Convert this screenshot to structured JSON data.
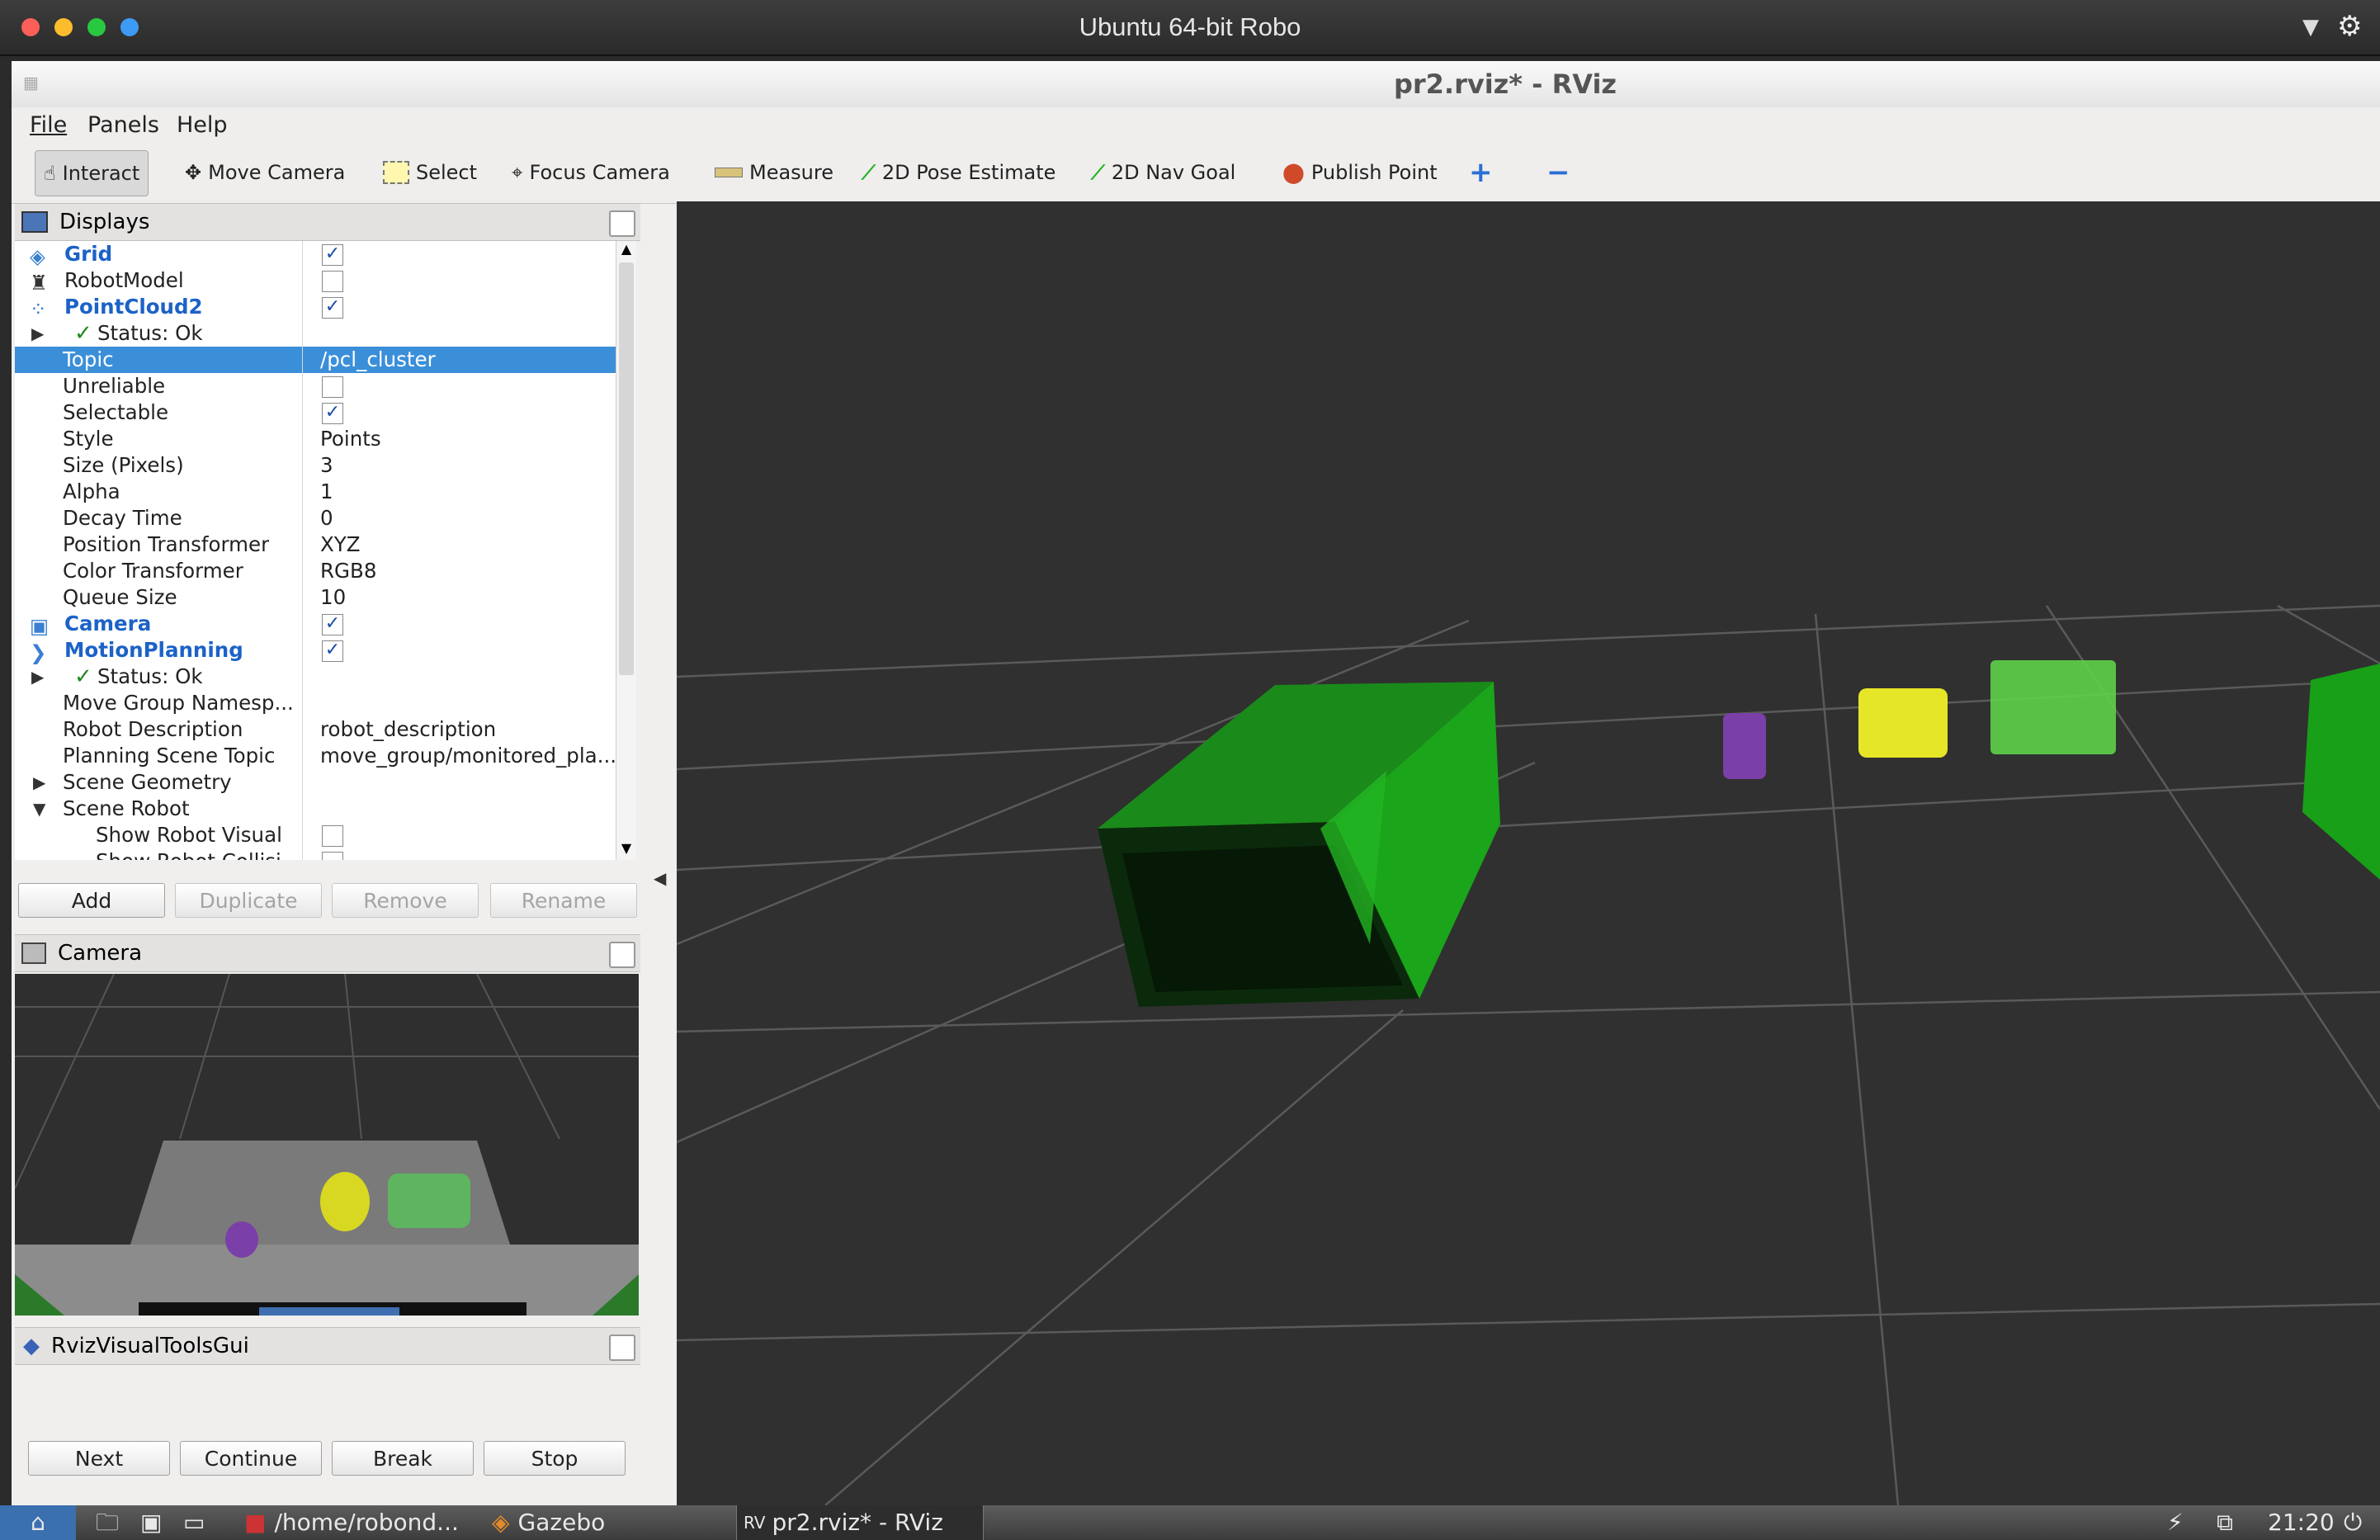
{
  "mac_window": {
    "title": "Ubuntu 64-bit Robo"
  },
  "rviz": {
    "title": "pr2.rviz* - RViz",
    "menu": [
      "File",
      "Panels",
      "Help"
    ],
    "toolbar": {
      "interact": "Interact",
      "move_camera": "Move Camera",
      "select": "Select",
      "focus_camera": "Focus Camera",
      "measure": "Measure",
      "pose_estimate": "2D Pose Estimate",
      "nav_goal": "2D Nav Goal",
      "publish_point": "Publish Point"
    },
    "displays": {
      "title": "Displays",
      "rows": [
        {
          "label": "Grid",
          "checked": "✓"
        },
        {
          "label": "RobotModel",
          "checked": ""
        },
        {
          "label": "PointCloud2",
          "checked": "✓"
        },
        {
          "label": "Status: Ok"
        },
        {
          "label": "Topic",
          "value": "/pcl_cluster"
        },
        {
          "label": "Unreliable",
          "checked": ""
        },
        {
          "label": "Selectable",
          "checked": "✓"
        },
        {
          "label": "Style",
          "value": "Points"
        },
        {
          "label": "Size (Pixels)",
          "value": "3"
        },
        {
          "label": "Alpha",
          "value": "1"
        },
        {
          "label": "Decay Time",
          "value": "0"
        },
        {
          "label": "Position Transformer",
          "value": "XYZ"
        },
        {
          "label": "Color Transformer",
          "value": "RGB8"
        },
        {
          "label": "Queue Size",
          "value": "10"
        },
        {
          "label": "Camera",
          "checked": "✓"
        },
        {
          "label": "MotionPlanning",
          "checked": "✓"
        },
        {
          "label": "Status: Ok"
        },
        {
          "label": "Move Group Namesp..."
        },
        {
          "label": "Robot Description",
          "value": "robot_description"
        },
        {
          "label": "Planning Scene Topic",
          "value": "move_group/monitored_pla..."
        },
        {
          "label": "Scene Geometry"
        },
        {
          "label": "Scene Robot"
        },
        {
          "label": "Show Robot Visual",
          "checked": ""
        },
        {
          "label": "Show Robot Collisi",
          "checked": ""
        }
      ],
      "buttons": {
        "add": "Add",
        "duplicate": "Duplicate",
        "remove": "Remove",
        "rename": "Rename"
      }
    },
    "camera_panel": {
      "title": "Camera"
    },
    "visual_tools": {
      "title": "RvizVisualToolsGui",
      "buttons": {
        "next": "Next",
        "continue": "Continue",
        "break": "Break",
        "stop": "Stop"
      }
    }
  },
  "taskbar": {
    "items": [
      "/home/robond...",
      "Gazebo",
      "pr2.rviz* - RViz"
    ],
    "clock": "21:20"
  },
  "colors": {
    "selection": "#3b8fd9",
    "link_blue": "#1c62c7",
    "box_green": "#1fa51f",
    "cloud_yellow": "#e6e628",
    "cloud_purple": "#7b3fa8"
  }
}
